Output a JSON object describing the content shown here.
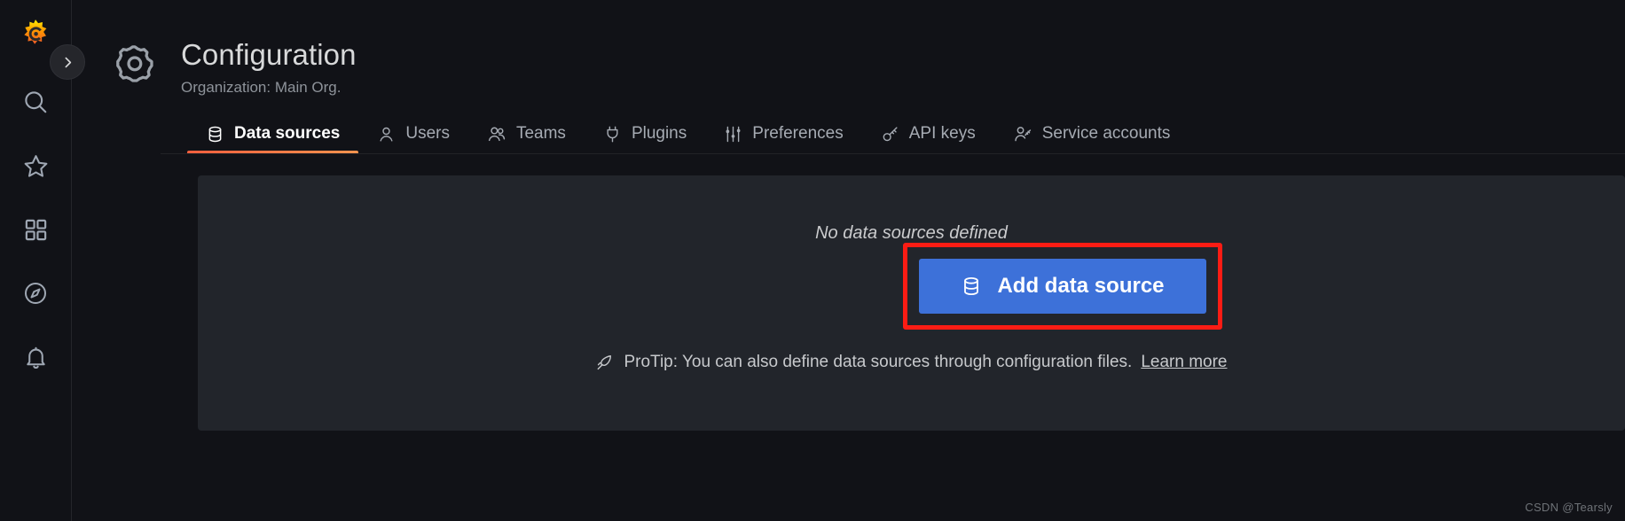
{
  "sidebar": {
    "logo_icon": "grafana-logo-icon",
    "expand_button_icon": "chevron-right-icon",
    "items": [
      {
        "key": "search",
        "icon": "search-icon",
        "label": "Search"
      },
      {
        "key": "starred",
        "icon": "star-icon",
        "label": "Starred"
      },
      {
        "key": "dashboards",
        "icon": "apps-grid-icon",
        "label": "Dashboards"
      },
      {
        "key": "explore",
        "icon": "compass-icon",
        "label": "Explore"
      },
      {
        "key": "alerting",
        "icon": "bell-icon",
        "label": "Alerting"
      }
    ]
  },
  "header": {
    "icon": "gear-icon",
    "title": "Configuration",
    "subtitle": "Organization: Main Org."
  },
  "tabs": [
    {
      "label": "Data sources",
      "icon": "database-icon",
      "active": true
    },
    {
      "label": "Users",
      "icon": "user-icon",
      "active": false
    },
    {
      "label": "Teams",
      "icon": "users-group-icon",
      "active": false
    },
    {
      "label": "Plugins",
      "icon": "plug-icon",
      "active": false
    },
    {
      "label": "Preferences",
      "icon": "sliders-icon",
      "active": false
    },
    {
      "label": "API keys",
      "icon": "key-icon",
      "active": false
    },
    {
      "label": "Service accounts",
      "icon": "user-key-icon",
      "active": false
    }
  ],
  "content": {
    "empty_title": "No data sources defined",
    "add_button": {
      "label": "Add data source",
      "icon": "database-icon",
      "color": "#3d71d9"
    },
    "annotation": {
      "shape": "rectangle",
      "color": "#fc1c14"
    },
    "protip": {
      "icon": "rocket-icon",
      "text": "ProTip: You can also define data sources through configuration files.",
      "link_label": "Learn more"
    }
  },
  "watermark": {
    "text": "CSDN @Tearsly"
  },
  "theme": {
    "page_bg": "#111217",
    "panel_bg": "#22252b",
    "sidebar_bg": "#111217",
    "accent_orange": "#f55f3e",
    "primary_blue": "#3d71d9",
    "text_primary": "#d8d9da",
    "text_secondary": "#8e939a"
  }
}
